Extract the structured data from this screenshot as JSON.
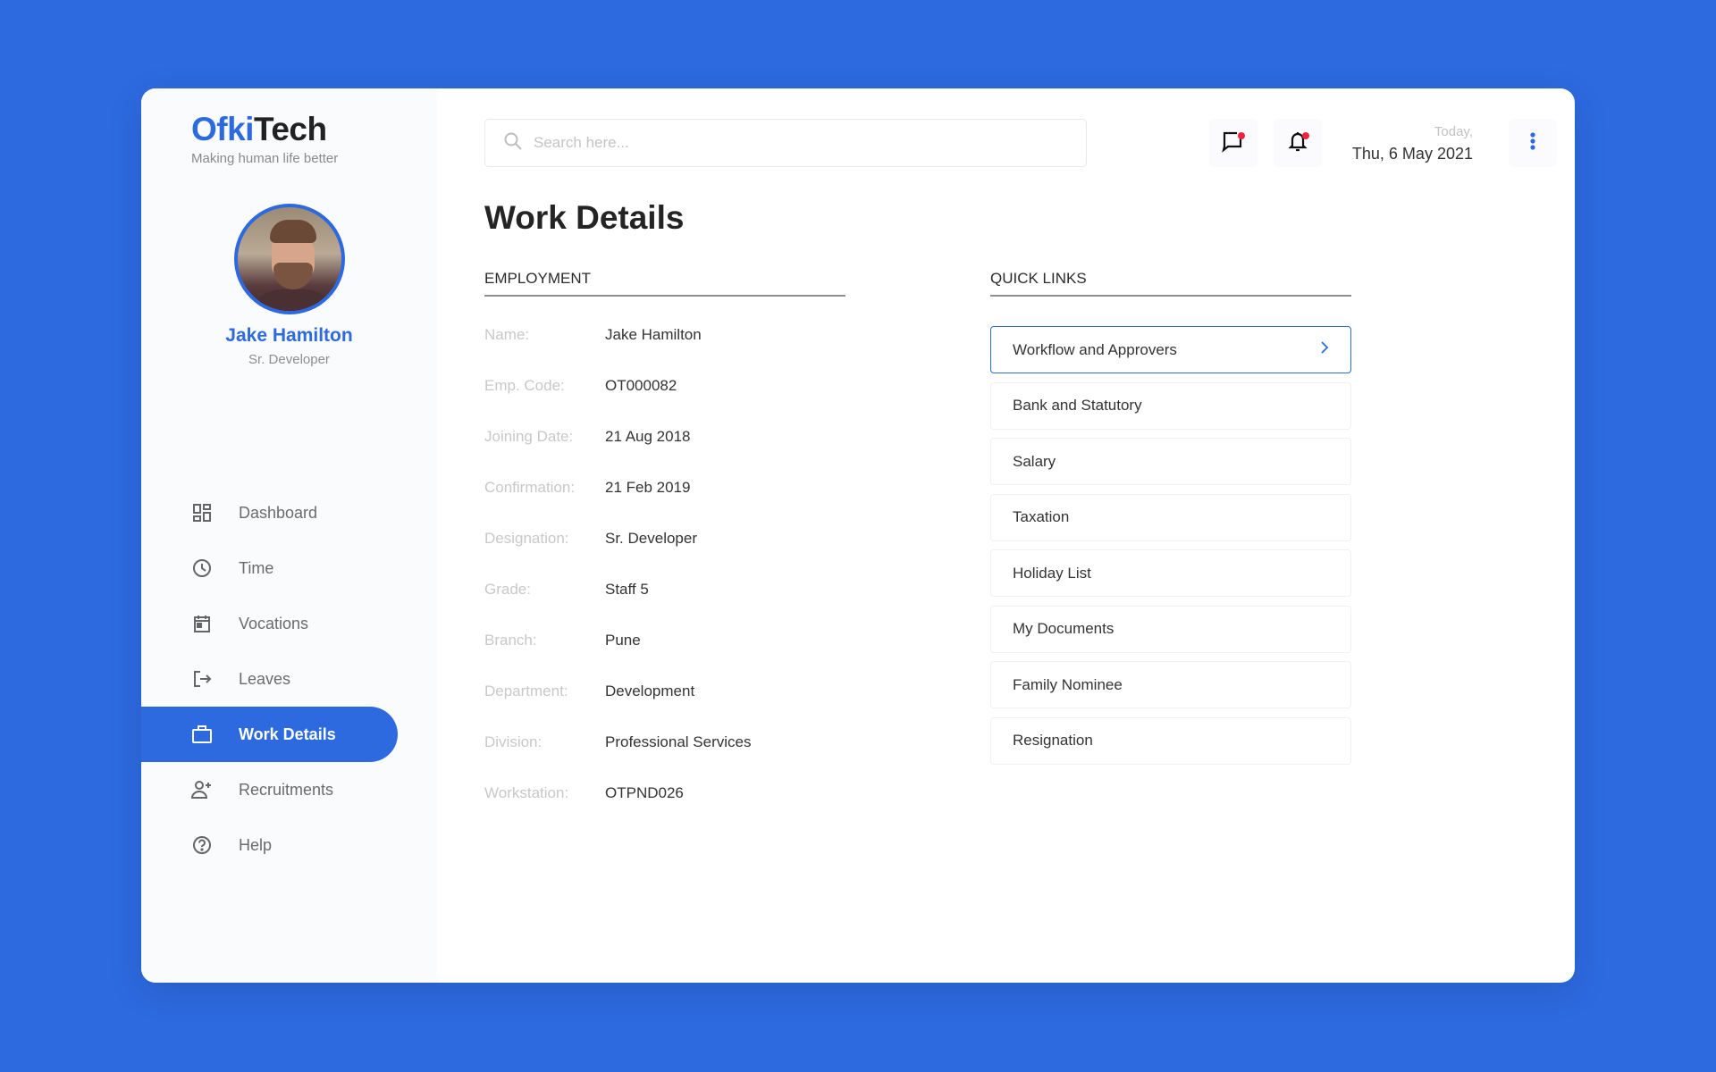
{
  "brand": {
    "name_part1": "Ofki",
    "name_part2": "Tech",
    "tagline": "Making human life better",
    "accent_color": "#2d6ae0"
  },
  "profile": {
    "name": "Jake Hamilton",
    "role": "Sr. Developer"
  },
  "sidebar": {
    "items": [
      {
        "label": "Dashboard",
        "icon": "dashboard-icon",
        "active": false
      },
      {
        "label": "Time",
        "icon": "clock-icon",
        "active": false
      },
      {
        "label": "Vocations",
        "icon": "calendar-icon",
        "active": false
      },
      {
        "label": "Leaves",
        "icon": "logout-icon",
        "active": false
      },
      {
        "label": "Work Details",
        "icon": "briefcase-icon",
        "active": true
      },
      {
        "label": "Recruitments",
        "icon": "add-user-icon",
        "active": false
      },
      {
        "label": "Help",
        "icon": "help-icon",
        "active": false
      }
    ]
  },
  "header": {
    "search_placeholder": "Search here...",
    "search_value": "",
    "messages_has_notification": true,
    "notifications_has_notification": true,
    "date_label": "Today,",
    "date_value": "Thu, 6 May 2021"
  },
  "main": {
    "title": "Work Details",
    "employment": {
      "heading": "EMPLOYMENT",
      "rows": [
        {
          "label": "Name:",
          "value": "Jake Hamilton"
        },
        {
          "label": "Emp. Code:",
          "value": "OT000082"
        },
        {
          "label": "Joining Date:",
          "value": "21 Aug 2018"
        },
        {
          "label": "Confirmation:",
          "value": "21 Feb 2019"
        },
        {
          "label": "Designation:",
          "value": "Sr. Developer"
        },
        {
          "label": "Grade:",
          "value": "Staff 5"
        },
        {
          "label": "Branch:",
          "value": "Pune"
        },
        {
          "label": "Department:",
          "value": "Development"
        },
        {
          "label": "Division:",
          "value": "Professional Services"
        },
        {
          "label": "Workstation:",
          "value": "OTPND026"
        }
      ]
    },
    "quick_links": {
      "heading": "QUICK LINKS",
      "items": [
        {
          "label": "Workflow and Approvers",
          "active": true
        },
        {
          "label": "Bank and Statutory",
          "active": false
        },
        {
          "label": "Salary",
          "active": false
        },
        {
          "label": "Taxation",
          "active": false
        },
        {
          "label": "Holiday List",
          "active": false
        },
        {
          "label": "My Documents",
          "active": false
        },
        {
          "label": "Family Nominee",
          "active": false
        },
        {
          "label": "Resignation",
          "active": false
        }
      ]
    }
  }
}
